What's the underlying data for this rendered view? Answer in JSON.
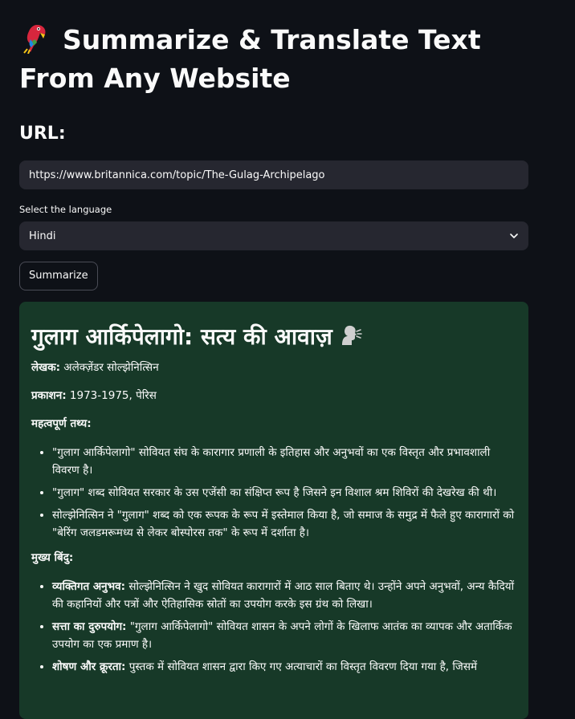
{
  "title": "Summarize & Translate Text From Any Website",
  "url_label": "URL:",
  "url_value": "https://www.britannica.com/topic/The-Gulag-Archipelago",
  "language_label": "Select the language",
  "language_value": "Hindi",
  "summarize_label": "Summarize",
  "result": {
    "heading": "गुलाग आर्किपेलागो: सत्य की आवाज़",
    "author_key": "लेखक:",
    "author_val": " अलेक्ज़ेंडर सोल्झेनित्सिन",
    "pub_key": "प्रकाशन:",
    "pub_val": " 1973-1975, पेरिस",
    "facts_heading": "महत्वपूर्ण तथ्य:",
    "facts": [
      "\"गुलाग आर्किपेलागो\" सोवियत संघ के कारागार प्रणाली के इतिहास और अनुभवों का एक विस्तृत और प्रभावशाली विवरण है।",
      "\"गुलाग\" शब्द सोवियत सरकार के उस एजेंसी का संक्षिप्त रूप है जिसने इन विशाल श्रम शिविरों की देखरेख की थी।",
      "सोल्झेनित्सिन ने \"गुलाग\" शब्द को एक रूपक के रूप में इस्तेमाल किया है, जो समाज के समुद्र में फैले हुए कारागारों को \"बेरिंग जलडमरूमध्य से लेकर बोस्पोरस तक\" के रूप में दर्शाता है।"
    ],
    "points_heading": "मुख्य बिंदु:",
    "points": [
      {
        "key": "व्यक्तिगत अनुभव:",
        "text": " सोल्झेनित्सिन ने खुद सोवियत कारागारों में आठ साल बिताए थे। उन्होंने अपने अनुभवों, अन्य कैदियों की कहानियों और पत्रों और ऐतिहासिक स्रोतों का उपयोग करके इस ग्रंथ को लिखा।"
      },
      {
        "key": "सत्ता का दुरुपयोग:",
        "text": " \"गुलाग आर्किपेलागो\" सोवियत शासन के अपने लोगों के खिलाफ आतंक का व्यापक और अतार्किक उपयोग का एक प्रमाण है।"
      },
      {
        "key": "शोषण और क्रूरता:",
        "text": " पुस्तक में सोवियत शासन द्वारा किए गए अत्याचारों का विस्तृत विवरण दिया गया है, जिसमें"
      }
    ]
  }
}
